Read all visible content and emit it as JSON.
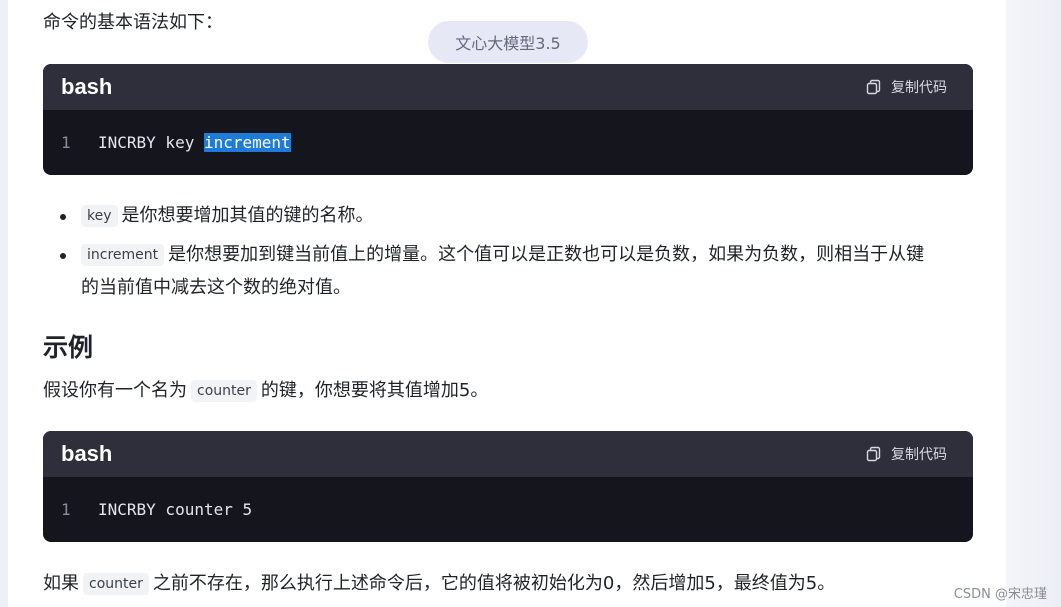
{
  "intro_text": "命令的基本语法如下：",
  "model_pill": "文心大模型3.5",
  "code_blocks": [
    {
      "lang": "bash",
      "copy_label": "复制代码",
      "line_number": "1",
      "code_before": "INCRBY key ",
      "code_selected": "increment"
    },
    {
      "lang": "bash",
      "copy_label": "复制代码",
      "line_number": "1",
      "code": "INCRBY counter 5"
    }
  ],
  "bullets": [
    {
      "code": "key",
      "text": "是你想要增加其值的键的名称。"
    },
    {
      "code": "increment",
      "text_line1": "是你想要加到键当前值上的增量。这个值可以是正数也可以是负数，如果为负数，则相当于从键",
      "text_line2": "的当前值中减去这个数的绝对值。"
    }
  ],
  "example_heading": "示例",
  "example_text_before": "假设你有一个名为",
  "example_code": "counter",
  "example_text_after": "的键，你想要将其值增加5。",
  "final_text_before": "如果",
  "final_code": "counter",
  "final_text_after": "之前不存在，那么执行上述命令后，它的值将被初始化为0，然后增加5，最终值为5。",
  "watermark": "CSDN @宋忠瑾",
  "icons": {
    "copy": "copy-icon"
  },
  "colors": {
    "selection": "#1e7bd8",
    "code_bg": "#15151e",
    "code_header": "#2e2f3b"
  }
}
